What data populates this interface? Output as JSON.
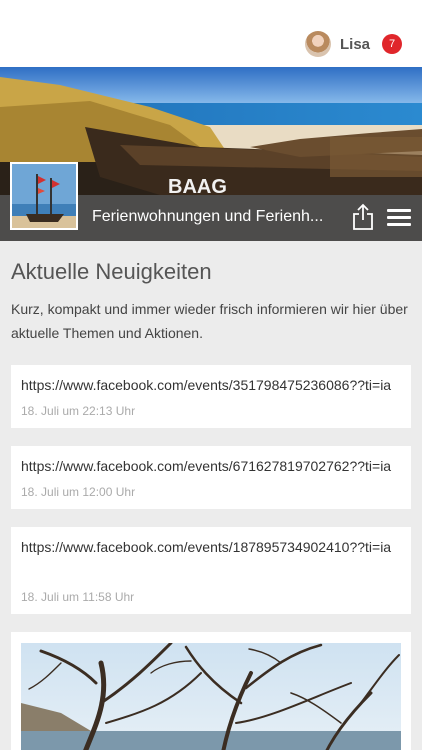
{
  "header": {
    "user_name": "Lisa",
    "notification_count": "7"
  },
  "hero": {
    "title": "Ferienwohnungen und Ferienh...",
    "share_icon": "share-icon",
    "menu_icon": "hamburger-menu-icon"
  },
  "main": {
    "section_title": "Aktuelle Neuigkeiten",
    "intro": "Kurz, kompakt und immer wieder frisch informieren wir hier über aktuelle Themen und Aktionen."
  },
  "posts": [
    {
      "text": "https://www.facebook.com/events/351798475236086??ti=ia",
      "time": "18. Juli um 22:13 Uhr"
    },
    {
      "text": "https://www.facebook.com/events/671627819702762??ti=ia",
      "time": "18. Juli um 12:00 Uhr"
    },
    {
      "text": "https://www.facebook.com/events/187895734902410??ti=ia",
      "time": "18. Juli um 11:58 Uhr"
    }
  ],
  "colors": {
    "badge": "#e0262b",
    "title_bar": "#505050",
    "background": "#ececec"
  }
}
